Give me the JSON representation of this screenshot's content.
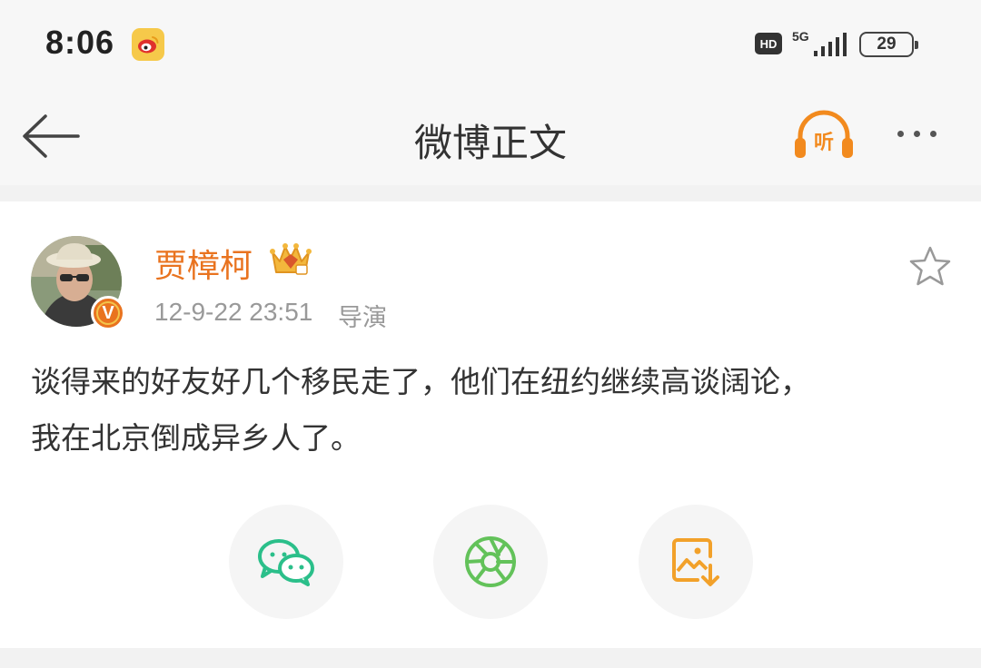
{
  "status_bar": {
    "time": "8:06",
    "app_icon": "weibo-icon",
    "hd": "HD",
    "network": "5G",
    "battery": "29"
  },
  "nav": {
    "back_icon": "arrow-left-icon",
    "title": "微博正文",
    "listen_label": "听",
    "listen_color": "#f28a1e",
    "more_icon": "more-dots-icon"
  },
  "post": {
    "author": "贾樟柯",
    "author_color": "#e9731f",
    "verified_label": "V",
    "member_icon": "crown-icon",
    "time": "12-9-22 23:51",
    "source": "导演",
    "favorite_icon": "star-outline-icon",
    "text_line1": "谈得来的好友好几个移民走了，他们在纽约继续高谈阔论，",
    "text_line2": "我在北京倒成异乡人了。"
  },
  "share": {
    "wechat_icon": "wechat-icon",
    "wechat_color": "#2bbf8a",
    "moments_icon": "moments-icon",
    "moments_color": "#63c25a",
    "save_icon": "save-image-icon",
    "save_color": "#f2a12a"
  }
}
